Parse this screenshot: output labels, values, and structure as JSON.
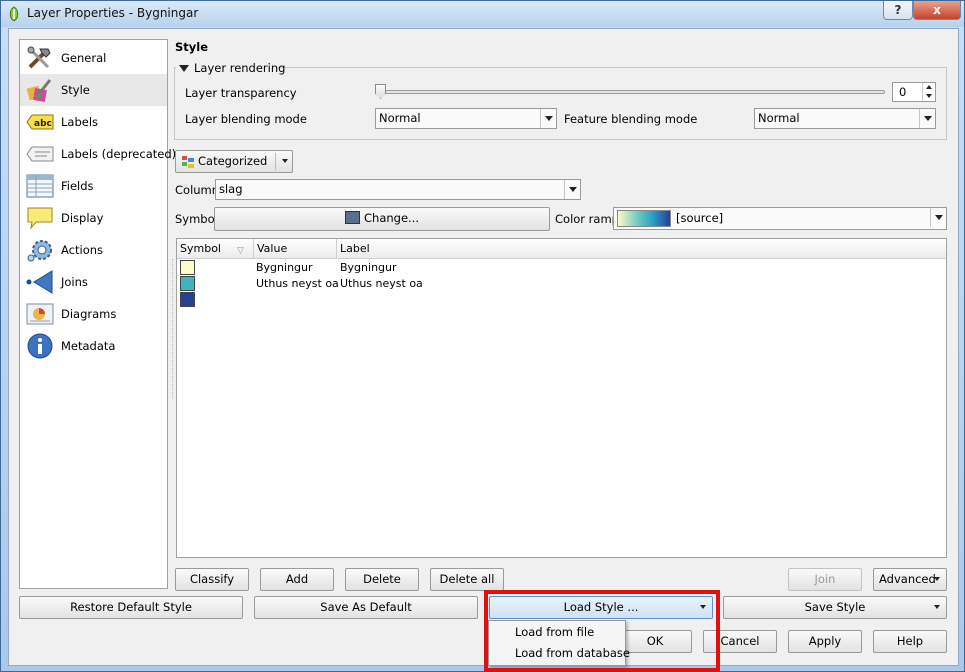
{
  "window": {
    "title": "Layer Properties - Bygningar",
    "help_label": "?",
    "close_label": "x"
  },
  "sidebar": {
    "items": [
      {
        "label": "General",
        "icon": "tools-icon"
      },
      {
        "label": "Style",
        "icon": "paintbrush-icon"
      },
      {
        "label": "Labels",
        "icon": "abc-label-icon"
      },
      {
        "label": "Labels (deprecated)",
        "icon": "label-deprecated-icon"
      },
      {
        "label": "Fields",
        "icon": "table-icon"
      },
      {
        "label": "Display",
        "icon": "speech-bubble-icon"
      },
      {
        "label": "Actions",
        "icon": "gear-icon"
      },
      {
        "label": "Joins",
        "icon": "join-arrow-icon"
      },
      {
        "label": "Diagrams",
        "icon": "diagram-icon"
      },
      {
        "label": "Metadata",
        "icon": "info-icon"
      }
    ],
    "selected": "Style"
  },
  "style": {
    "heading": "Style",
    "rendering": {
      "title": "Layer rendering",
      "transparency_label": "Layer transparency",
      "transparency_value": "0",
      "blending_label": "Layer blending mode",
      "blending_value": "Normal",
      "feature_blending_label": "Feature blending mode",
      "feature_blending_value": "Normal"
    },
    "renderer": "Categorized",
    "column_label": "Column",
    "column_value": "slag",
    "symbol_label": "Symbol",
    "change_label": "Change...",
    "color_ramp_label": "Color ramp",
    "color_ramp_value": "[source]",
    "table": {
      "headers": [
        "Symbol",
        "Value",
        "Label"
      ],
      "rows": [
        {
          "color": "#fdfbc8",
          "value": "Bygningur",
          "label": "Bygningur"
        },
        {
          "color": "#3fb2c4",
          "value": "Uthus neyst oa",
          "label": "Uthus neyst oa"
        },
        {
          "color": "#26409a",
          "value": "",
          "label": ""
        }
      ]
    },
    "buttons": {
      "classify": "Classify",
      "add": "Add",
      "delete": "Delete",
      "delete_all": "Delete all",
      "join": "Join",
      "advanced": "Advanced"
    }
  },
  "bottom": {
    "restore_default": "Restore Default Style",
    "save_as_default": "Save As Default",
    "load_style": "Load Style ...",
    "save_style": "Save Style",
    "ok": "OK",
    "cancel": "Cancel",
    "apply": "Apply",
    "help": "Help"
  },
  "load_menu": {
    "items": [
      "Load from file",
      "Load from database"
    ]
  },
  "colors": {
    "highlight": "#e01010",
    "symbol_swatch": "#5b6e8c"
  }
}
